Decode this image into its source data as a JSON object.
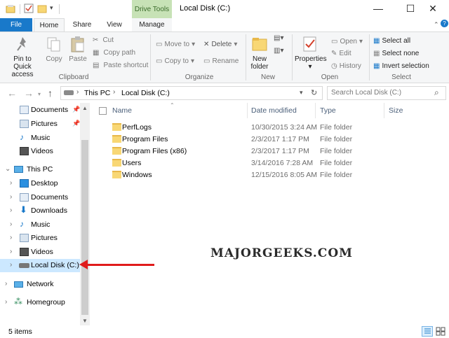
{
  "window": {
    "title": "Local Disk (C:)",
    "context_tab": "Drive Tools",
    "controls": {
      "minimize": "—",
      "maximize": "☐",
      "close": "✕"
    }
  },
  "ribbon_tabs": [
    "File",
    "Home",
    "Share",
    "View",
    "Manage"
  ],
  "ribbon": {
    "clipboard": {
      "group": "Clipboard",
      "pin": "Pin to Quick access",
      "copy": "Copy",
      "paste": "Paste",
      "cut": "Cut",
      "copy_path": "Copy path",
      "paste_shortcut": "Paste shortcut"
    },
    "organize": {
      "group": "Organize",
      "move_to": "Move to",
      "copy_to": "Copy to",
      "delete": "Delete",
      "rename": "Rename"
    },
    "new": {
      "group": "New",
      "new_folder": "New folder"
    },
    "open": {
      "group": "Open",
      "properties": "Properties",
      "open": "Open",
      "edit": "Edit",
      "history": "History"
    },
    "select": {
      "group": "Select",
      "select_all": "Select all",
      "select_none": "Select none",
      "invert": "Invert selection"
    }
  },
  "address": {
    "crumbs": [
      "This PC",
      "Local Disk (C:)"
    ],
    "search_placeholder": "Search Local Disk (C:)"
  },
  "nav": {
    "quick": [
      {
        "label": "Documents",
        "icon": "documents-icon"
      },
      {
        "label": "Pictures",
        "icon": "pictures-icon"
      },
      {
        "label": "Music",
        "icon": "music-icon"
      },
      {
        "label": "Videos",
        "icon": "videos-icon"
      }
    ],
    "this_pc": "This PC",
    "pc_items": [
      {
        "label": "Desktop",
        "icon": "desktop-icon"
      },
      {
        "label": "Documents",
        "icon": "documents-icon"
      },
      {
        "label": "Downloads",
        "icon": "downloads-icon"
      },
      {
        "label": "Music",
        "icon": "music-icon"
      },
      {
        "label": "Pictures",
        "icon": "pictures-icon"
      },
      {
        "label": "Videos",
        "icon": "videos-icon"
      },
      {
        "label": "Local Disk (C:)",
        "icon": "drive-icon"
      }
    ],
    "network": "Network",
    "homegroup": "Homegroup"
  },
  "columns": {
    "name": "Name",
    "date": "Date modified",
    "type": "Type",
    "size": "Size"
  },
  "files": [
    {
      "name": "PerfLogs",
      "date": "10/30/2015 3:24 AM",
      "type": "File folder"
    },
    {
      "name": "Program Files",
      "date": "2/3/2017 1:17 PM",
      "type": "File folder"
    },
    {
      "name": "Program Files (x86)",
      "date": "2/3/2017 1:17 PM",
      "type": "File folder"
    },
    {
      "name": "Users",
      "date": "3/14/2016 7:28 AM",
      "type": "File folder"
    },
    {
      "name": "Windows",
      "date": "12/15/2016 8:05 AM",
      "type": "File folder"
    }
  ],
  "status": {
    "count": "5 items"
  },
  "watermark": "MAJORGEEKS.COM",
  "colors": {
    "accent": "#1979ca",
    "selection": "#cce8ff",
    "arrow": "#e01c1c",
    "folder": "#f8d775"
  }
}
